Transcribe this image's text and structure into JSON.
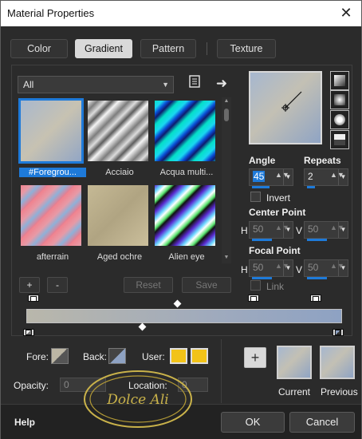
{
  "window": {
    "title": "Material Properties",
    "close_glyph": "✕"
  },
  "tabs": [
    {
      "label": "Color",
      "active": false
    },
    {
      "label": "Gradient",
      "active": true
    },
    {
      "label": "Pattern",
      "active": false
    },
    {
      "label": "Texture",
      "active": false
    }
  ],
  "library": {
    "category": "All",
    "items": [
      {
        "name": "#Foregrou...",
        "selected": true
      },
      {
        "name": "Acciaio",
        "selected": false
      },
      {
        "name": "Acqua multi...",
        "selected": false
      },
      {
        "name": "afterrain",
        "selected": false
      },
      {
        "name": "Aged ochre",
        "selected": false
      },
      {
        "name": "Alien eye",
        "selected": false
      }
    ],
    "add_label": "+",
    "remove_label": "-",
    "reset_label": "Reset",
    "save_label": "Save"
  },
  "settings": {
    "angle_label": "Angle",
    "angle_value": "45",
    "repeats_label": "Repeats",
    "repeats_value": "2",
    "invert_label": "Invert",
    "center_point_label": "Center Point",
    "center_h_label": "H",
    "center_h_value": "50",
    "center_v_label": "V",
    "center_v_value": "50",
    "focal_point_label": "Focal Point",
    "focal_h_label": "H",
    "focal_h_value": "50",
    "focal_v_label": "V",
    "focal_v_value": "50",
    "link_label": "Link"
  },
  "editor": {
    "fore_label": "Fore:",
    "back_label": "Back:",
    "user_label": "User:",
    "user_color": "#f2c318",
    "opacity_label": "Opacity:",
    "opacity_value": "0",
    "location_label": "Location:",
    "location_value": "0",
    "add_stop_label": "+"
  },
  "compare": {
    "current_label": "Current",
    "previous_label": "Previous"
  },
  "footer": {
    "help_label": "Help",
    "ok_label": "OK",
    "cancel_label": "Cancel"
  },
  "colors": {
    "accent": "#1e7ad9",
    "dialog_bg": "#2b2b2b"
  },
  "watermark": {
    "text": "Dolce Ali"
  }
}
